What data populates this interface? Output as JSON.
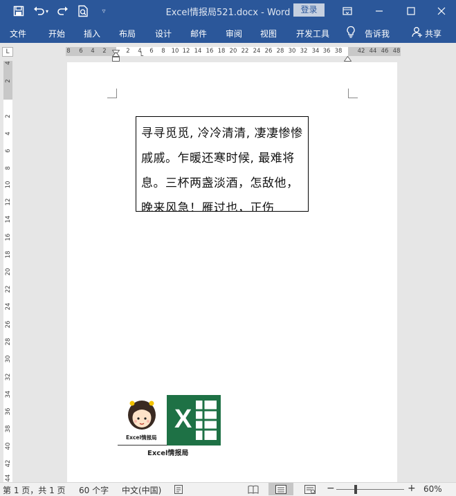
{
  "window": {
    "title": "Excel情报局521.docx  -  Word",
    "login_label": "登录"
  },
  "menu": {
    "items": [
      "文件",
      "开始",
      "插入",
      "布局",
      "设计",
      "邮件",
      "审阅",
      "视图",
      "开发工具"
    ],
    "tell_me": "告诉我",
    "share": "共享"
  },
  "ruler": {
    "corner": "L",
    "h_numbers": [
      "8",
      "6",
      "4",
      "2",
      "2",
      "4",
      "6",
      "8",
      "10",
      "12",
      "14",
      "16",
      "18",
      "20",
      "22",
      "24",
      "26",
      "28",
      "30",
      "32",
      "34",
      "36",
      "38",
      "42",
      "44",
      "46",
      "48"
    ],
    "v_numbers": [
      "4",
      "2",
      "2",
      "4",
      "6",
      "8",
      "10",
      "12",
      "14",
      "16",
      "18",
      "20",
      "22",
      "24",
      "26",
      "28",
      "30",
      "32",
      "34",
      "36",
      "38",
      "40",
      "42",
      "44"
    ]
  },
  "document": {
    "textbox_text": "寻寻觅觅, 冷冷清清, 凄凄惨惨戚戚。乍暖还寒时候, 最难将息。三杯两盏淡酒，怎敌他，晚来风急！雁过也，正伤",
    "mascot_label": "Excel情报局",
    "logo_caption": "Excel情报局",
    "logo_letter": "X"
  },
  "status": {
    "page": "第 1 页，共 1 页",
    "words": "60 个字",
    "language": "中文(中国)",
    "zoom": "60%",
    "zoom_minus": "−",
    "zoom_plus": "+"
  },
  "colors": {
    "accent": "#2b579a",
    "excel_green": "#1e7145"
  }
}
